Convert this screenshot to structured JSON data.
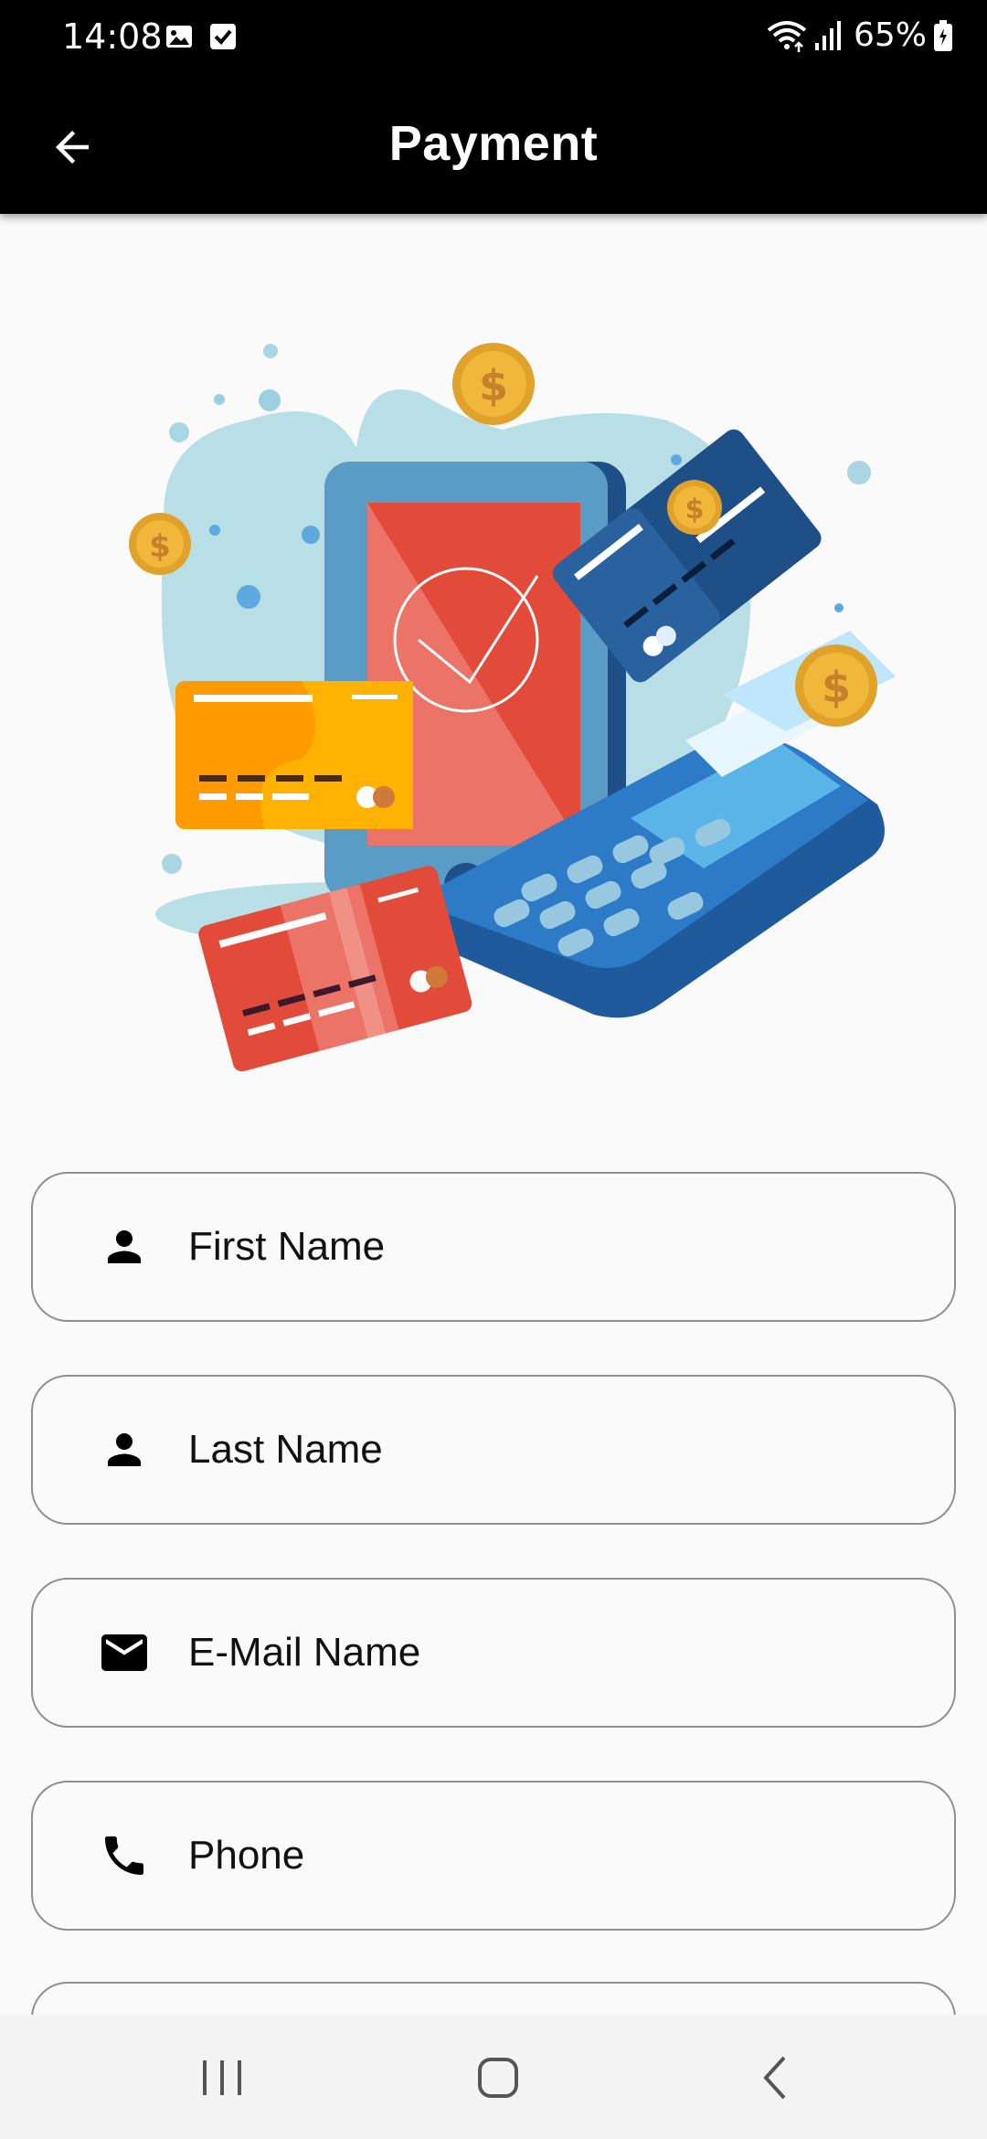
{
  "status_bar": {
    "time": "14:08",
    "battery": "65%",
    "icons": [
      "gallery-icon",
      "checkbox-icon",
      "wifi-icon",
      "signal-icon",
      "battery-icon"
    ]
  },
  "app_bar": {
    "title": "Payment",
    "back_icon": "arrow-back-icon"
  },
  "form": {
    "fields": [
      {
        "placeholder": "First Name",
        "icon": "person-icon",
        "value": ""
      },
      {
        "placeholder": "Last Name",
        "icon": "person-icon",
        "value": ""
      },
      {
        "placeholder": "E-Mail Name",
        "icon": "mail-icon",
        "value": ""
      },
      {
        "placeholder": "Phone",
        "icon": "phone-icon",
        "value": ""
      }
    ]
  },
  "nav_bar": {
    "buttons": [
      "recents-icon",
      "home-icon",
      "back-icon"
    ]
  },
  "colors": {
    "app_bar": "#000000",
    "background": "#fafafa",
    "field_border": "#8e8e8e",
    "illustration_blue": "#2f6fae",
    "illustration_red": "#e04a3a",
    "illustration_orange": "#ffa500",
    "coin": "#f0b73a"
  }
}
